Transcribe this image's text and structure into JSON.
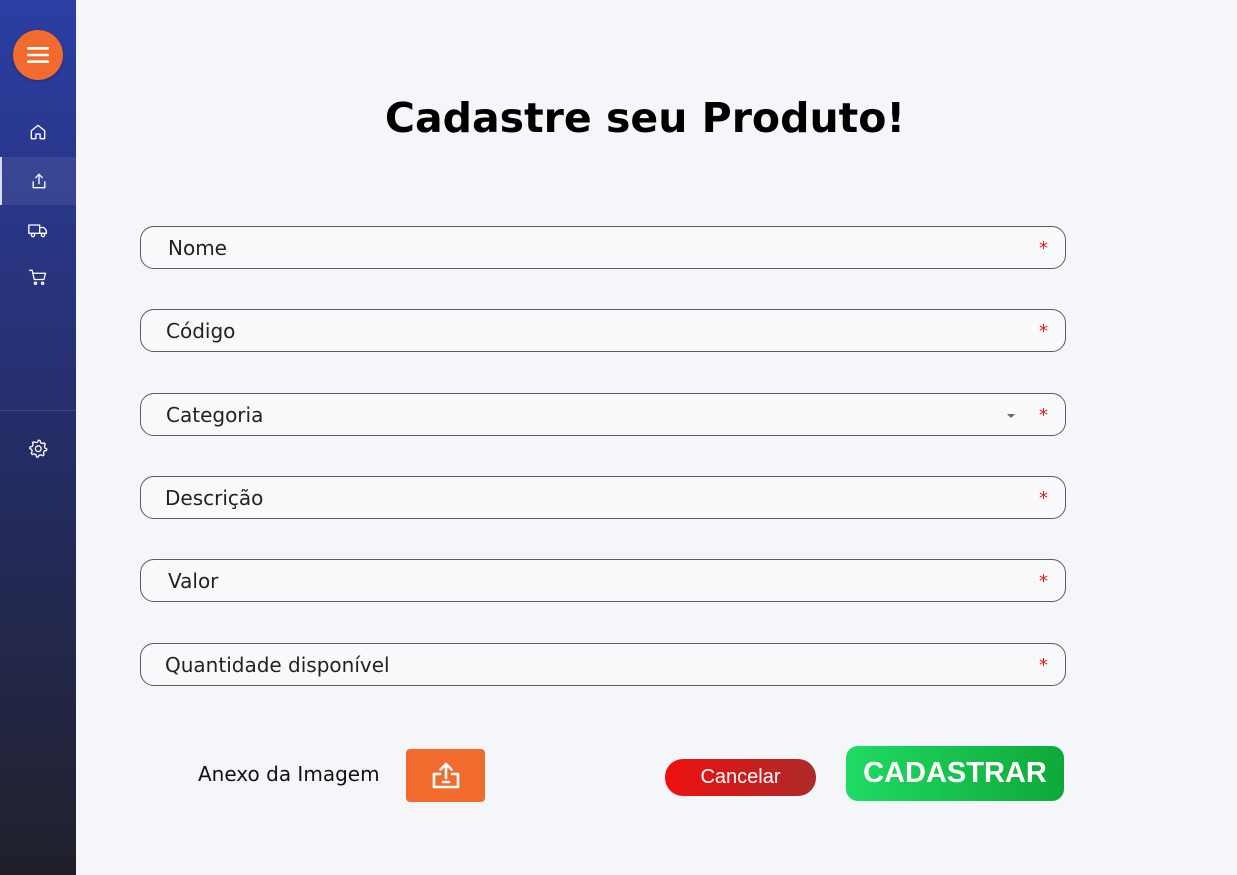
{
  "sidebar": {
    "menu_icon": "hamburger-menu-icon",
    "items": [
      {
        "icon": "home-icon"
      },
      {
        "icon": "upload-icon",
        "active": true
      },
      {
        "icon": "truck-icon"
      },
      {
        "icon": "shopping-cart-icon"
      }
    ],
    "settings_icon": "gear-icon"
  },
  "page": {
    "title": "Cadastre seu Produto!"
  },
  "form": {
    "fields": [
      {
        "placeholder": "Nome",
        "required_mark": "*"
      },
      {
        "placeholder": "Código",
        "required_mark": "*"
      },
      {
        "placeholder": "Categoria",
        "required_mark": "*",
        "type": "select"
      },
      {
        "placeholder": "Descrição",
        "required_mark": "*"
      },
      {
        "placeholder": "Valor",
        "required_mark": "*"
      },
      {
        "placeholder": "Quantidade disponível",
        "required_mark": "*"
      }
    ],
    "attachment_label": "Anexo da Imagem",
    "cancel_label": "Cancelar",
    "submit_label": "CADASTRAR"
  },
  "colors": {
    "accent_orange": "#f26b2e",
    "cancel_red": "#ee1111",
    "submit_green": "#1fdb64",
    "required_red": "#e01b1b"
  }
}
